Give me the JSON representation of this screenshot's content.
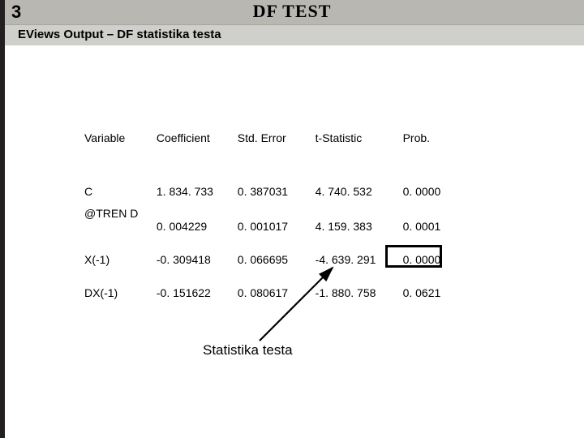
{
  "slide_number": "3",
  "title": "DF TEST",
  "subtitle": "EViews Output – DF statistika testa",
  "table": {
    "headers": [
      "Variable",
      "Coefficient",
      "Std. Error",
      "t-Statistic",
      "Prob."
    ],
    "rows": [
      {
        "var": "C",
        "coef": "1. 834. 733",
        "se": "0. 387031",
        "t": "4. 740. 532",
        "p": "0. 0000"
      },
      {
        "var": "@TREN D",
        "coef": "0. 004229",
        "se": "0. 001017",
        "t": "4. 159. 383",
        "p": "0. 0001"
      },
      {
        "var": "X(-1)",
        "coef": "-0. 309418",
        "se": "0. 066695",
        "t": "-4. 639. 291",
        "p": "0. 0000"
      },
      {
        "var": "DX(-1)",
        "coef": "-0. 151622",
        "se": "0. 080617",
        "t": "-1. 880. 758",
        "p": "0. 0621"
      }
    ]
  },
  "caption": "Statistika testa"
}
